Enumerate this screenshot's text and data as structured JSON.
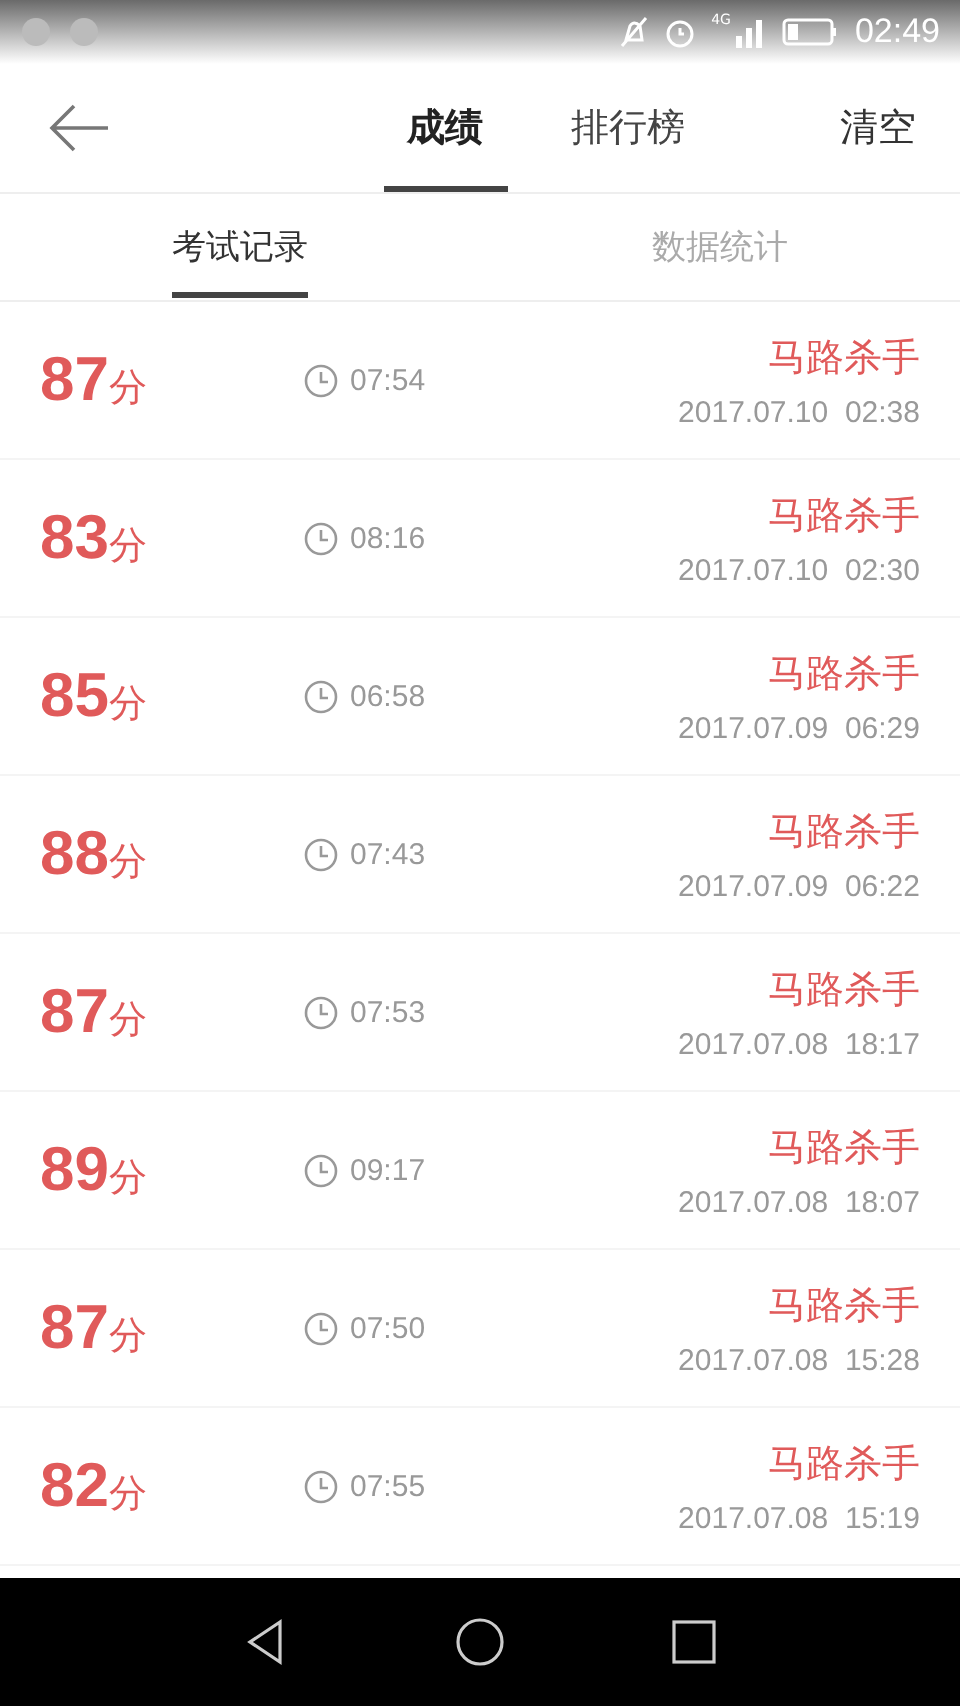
{
  "status_bar": {
    "network": "4G",
    "time": "02:49"
  },
  "header": {
    "tabs": [
      {
        "label": "成绩",
        "selected": true
      },
      {
        "label": "排行榜",
        "selected": false
      }
    ],
    "action": "清空"
  },
  "subtabs": [
    {
      "label": "考试记录",
      "selected": true
    },
    {
      "label": "数据统计",
      "selected": false
    }
  ],
  "records": [
    {
      "score": "87",
      "unit": "分",
      "duration": "07:54",
      "title": "马路杀手",
      "date": "2017.07.10  02:38"
    },
    {
      "score": "83",
      "unit": "分",
      "duration": "08:16",
      "title": "马路杀手",
      "date": "2017.07.10  02:30"
    },
    {
      "score": "85",
      "unit": "分",
      "duration": "06:58",
      "title": "马路杀手",
      "date": "2017.07.09  06:29"
    },
    {
      "score": "88",
      "unit": "分",
      "duration": "07:43",
      "title": "马路杀手",
      "date": "2017.07.09  06:22"
    },
    {
      "score": "87",
      "unit": "分",
      "duration": "07:53",
      "title": "马路杀手",
      "date": "2017.07.08  18:17"
    },
    {
      "score": "89",
      "unit": "分",
      "duration": "09:17",
      "title": "马路杀手",
      "date": "2017.07.08  18:07"
    },
    {
      "score": "87",
      "unit": "分",
      "duration": "07:50",
      "title": "马路杀手",
      "date": "2017.07.08  15:28"
    },
    {
      "score": "82",
      "unit": "分",
      "duration": "07:55",
      "title": "马路杀手",
      "date": "2017.07.08  15:19"
    }
  ]
}
